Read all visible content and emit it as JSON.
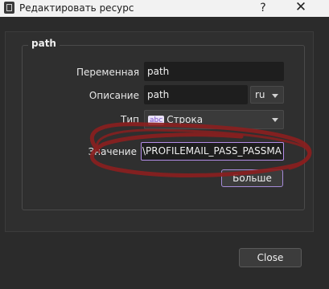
{
  "window": {
    "title": "Редактировать ресурс",
    "help": "?",
    "close": "✕"
  },
  "group": {
    "title": "path"
  },
  "fields": {
    "variable": {
      "label": "Переменная",
      "value": "path"
    },
    "description": {
      "label": "Описание",
      "value": "path",
      "lang": "ru"
    },
    "type": {
      "label": "Тип",
      "icon_text": "abc",
      "value": "Строка"
    },
    "value": {
      "label": "Значение",
      "value": "\\PROFILEMAIL_PASS_PASSMA"
    }
  },
  "buttons": {
    "more": "Больше",
    "close": "Close"
  },
  "colors": {
    "annotation": "#8a1f1f",
    "focus_border": "#b48de8"
  }
}
